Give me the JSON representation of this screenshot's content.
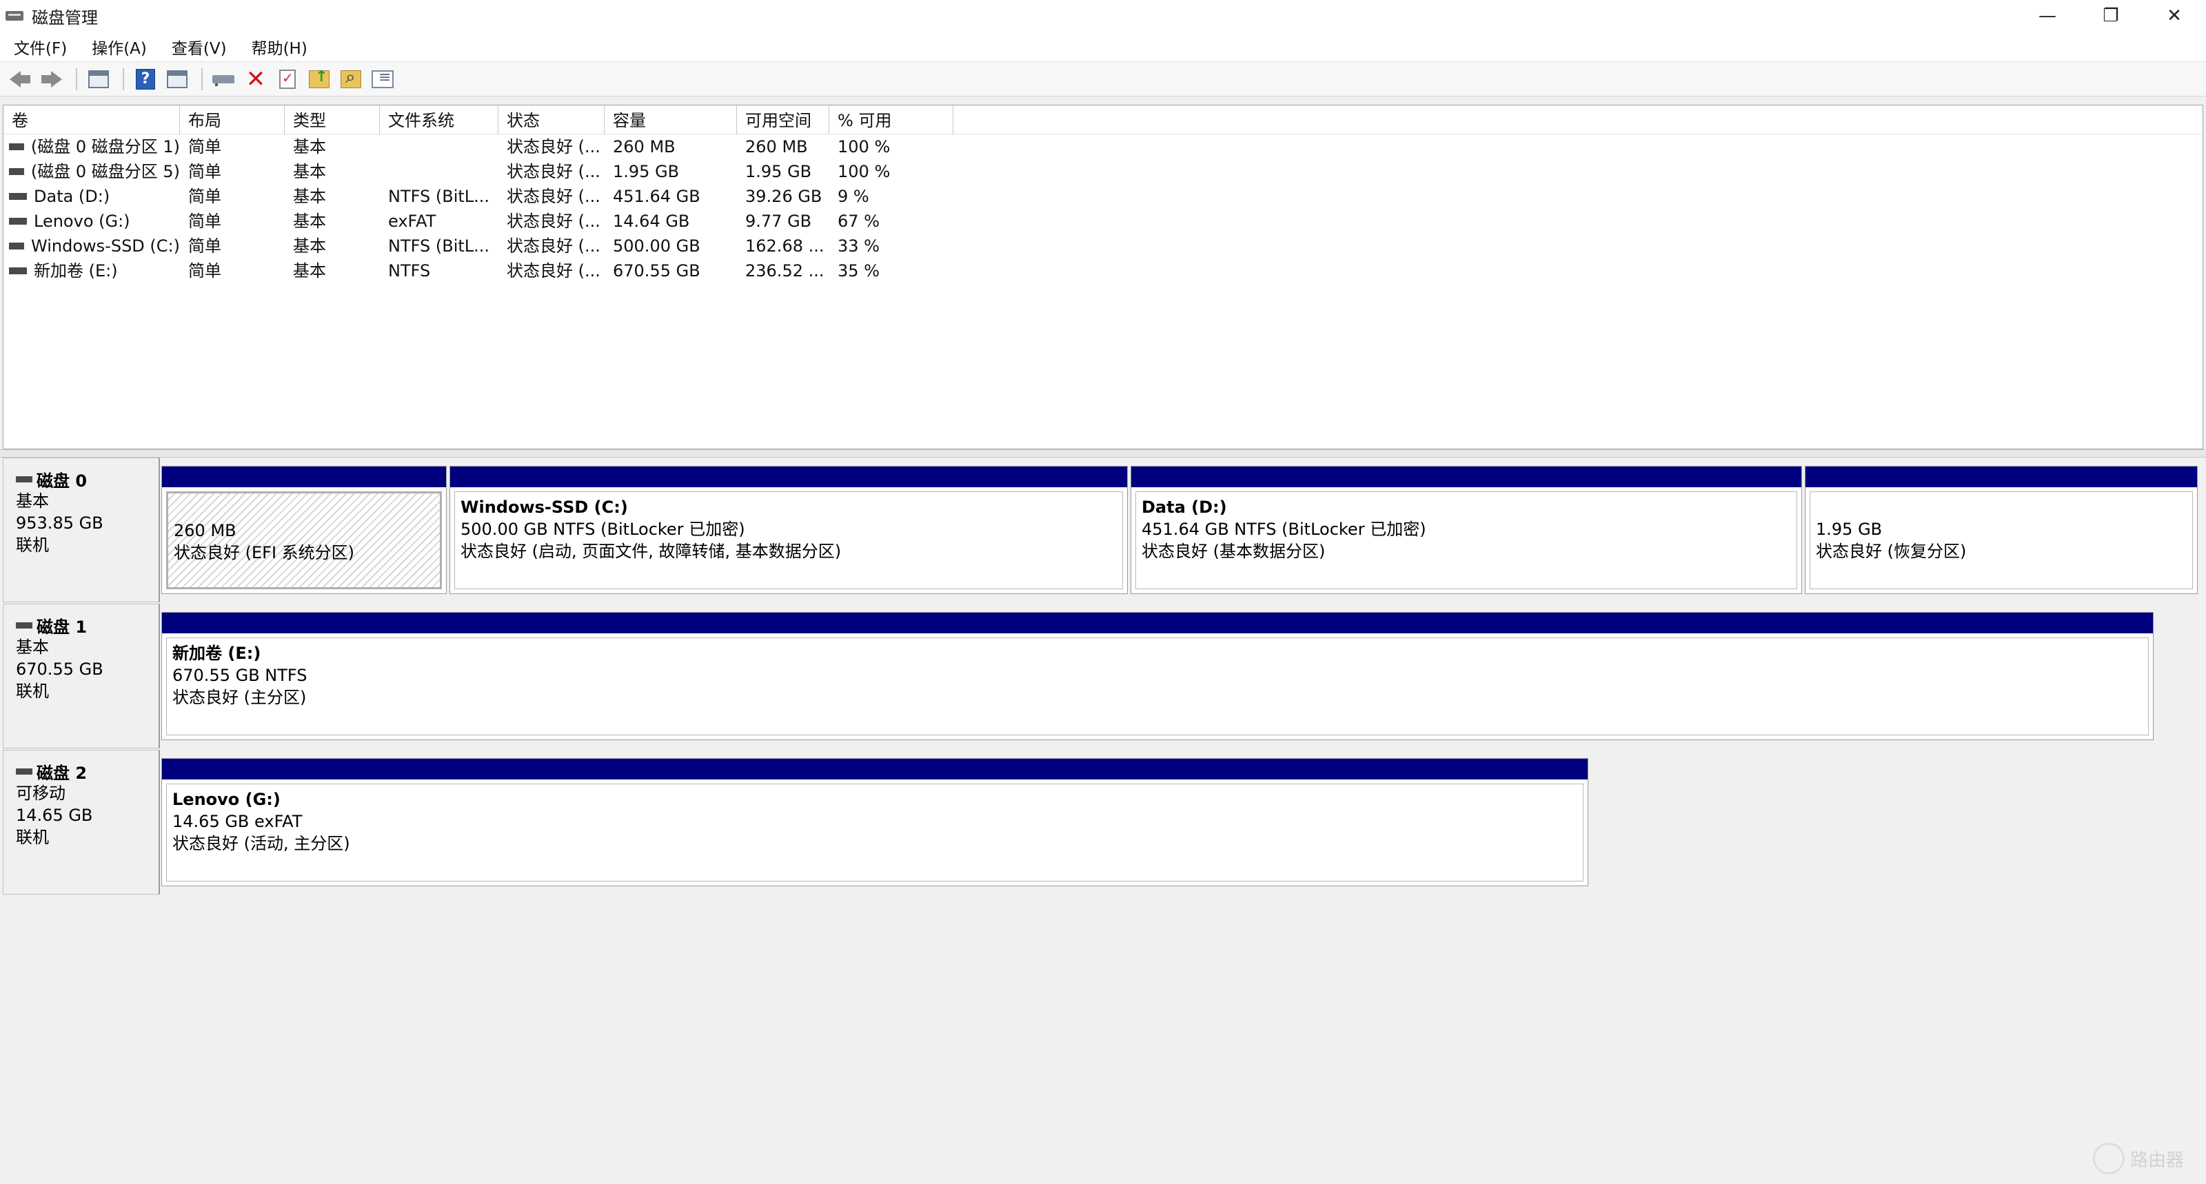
{
  "window": {
    "title": "磁盘管理",
    "controls": {
      "minimize": "—",
      "restore": "❐",
      "close": "✕"
    }
  },
  "menu": [
    "文件(F)",
    "操作(A)",
    "查看(V)",
    "帮助(H)"
  ],
  "table": {
    "headers": [
      "卷",
      "布局",
      "类型",
      "文件系统",
      "状态",
      "容量",
      "可用空间",
      "% 可用"
    ],
    "rows": [
      [
        "(磁盘 0 磁盘分区 1)",
        "简单",
        "基本",
        "",
        "状态良好 (...",
        "260 MB",
        "260 MB",
        "100 %"
      ],
      [
        "(磁盘 0 磁盘分区 5)",
        "简单",
        "基本",
        "",
        "状态良好 (...",
        "1.95 GB",
        "1.95 GB",
        "100 %"
      ],
      [
        "Data (D:)",
        "简单",
        "基本",
        "NTFS (BitL...",
        "状态良好 (...",
        "451.64 GB",
        "39.26 GB",
        "9 %"
      ],
      [
        "Lenovo (G:)",
        "简单",
        "基本",
        "exFAT",
        "状态良好 (...",
        "14.64 GB",
        "9.77 GB",
        "67 %"
      ],
      [
        "Windows-SSD (C:)",
        "简单",
        "基本",
        "NTFS (BitL...",
        "状态良好 (...",
        "500.00 GB",
        "162.68 ...",
        "33 %"
      ],
      [
        "新加卷 (E:)",
        "简单",
        "基本",
        "NTFS",
        "状态良好 (...",
        "670.55 GB",
        "236.52 ...",
        "35 %"
      ]
    ]
  },
  "disks": [
    {
      "name": "磁盘 0",
      "type": "基本",
      "size": "953.85 GB",
      "status": "联机",
      "partitions": [
        {
          "title": "",
          "line1": "260 MB",
          "line2": "状态良好 (EFI 系统分区)"
        },
        {
          "title": "Windows-SSD  (C:)",
          "line1": "500.00 GB NTFS (BitLocker 已加密)",
          "line2": "状态良好 (启动, 页面文件, 故障转储, 基本数据分区)"
        },
        {
          "title": "Data  (D:)",
          "line1": "451.64 GB NTFS (BitLocker 已加密)",
          "line2": "状态良好 (基本数据分区)"
        },
        {
          "title": "",
          "line1": "1.95 GB",
          "line2": "状态良好 (恢复分区)"
        }
      ]
    },
    {
      "name": "磁盘 1",
      "type": "基本",
      "size": "670.55 GB",
      "status": "联机",
      "partitions": [
        {
          "title": "新加卷  (E:)",
          "line1": "670.55 GB NTFS",
          "line2": "状态良好 (主分区)"
        }
      ]
    },
    {
      "name": "磁盘 2",
      "type": "可移动",
      "size": "14.65 GB",
      "status": "联机",
      "partitions": [
        {
          "title": "Lenovo  (G:)",
          "line1": "14.65 GB exFAT",
          "line2": "状态良好 (活动, 主分区)"
        }
      ]
    }
  ],
  "watermark": "路由器",
  "colors": {
    "partition_bar": "#00007f",
    "delete_icon": "#d01414"
  }
}
